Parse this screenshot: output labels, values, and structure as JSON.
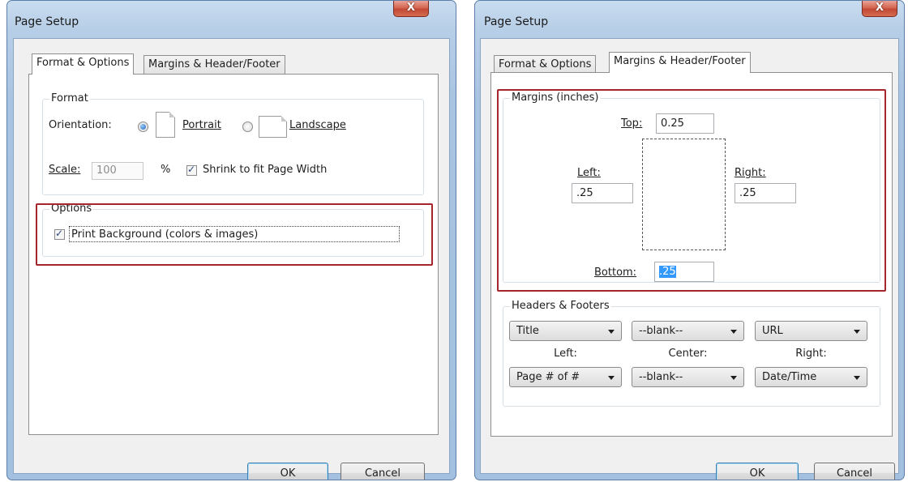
{
  "dialog1": {
    "title": "Page Setup",
    "close_label": "X",
    "tabs": [
      {
        "label": "Format & Options",
        "active": true
      },
      {
        "label": "Margins & Header/Footer",
        "active": false
      }
    ],
    "format": {
      "group_label": "Format",
      "orientation_label": "Orientation:",
      "portrait_label": "Portrait",
      "landscape_label": "Landscape",
      "orientation_selected": "Portrait",
      "scale_label": "Scale:",
      "scale_value": "100",
      "scale_unit": "%",
      "shrink_label": "Shrink to fit Page Width",
      "shrink_checked": true
    },
    "options": {
      "group_label": "Options",
      "print_background_label": "Print Background (colors & images)",
      "print_background_checked": true
    },
    "ok_label": "OK",
    "cancel_label": "Cancel"
  },
  "dialog2": {
    "title": "Page Setup",
    "close_label": "X",
    "tabs": [
      {
        "label": "Format & Options",
        "active": false
      },
      {
        "label": "Margins & Header/Footer",
        "active": true
      }
    ],
    "margins": {
      "group_label": "Margins (inches)",
      "top_label": "Top:",
      "top_value": "0.25",
      "left_label": "Left:",
      "left_value": ".25",
      "right_label": "Right:",
      "right_value": ".25",
      "bottom_label": "Bottom:",
      "bottom_value": ".25"
    },
    "headers_footers": {
      "group_label": "Headers & Footers",
      "header_left": "Title",
      "header_center": "--blank--",
      "header_right": "URL",
      "left_label": "Left:",
      "center_label": "Center:",
      "right_label": "Right:",
      "footer_left": "Page # of #",
      "footer_center": "--blank--",
      "footer_right": "Date/Time"
    },
    "ok_label": "OK",
    "cancel_label": "Cancel"
  },
  "colors": {
    "highlight": "#a5262c",
    "window_frame": "#a9c4e2",
    "close_button": "#c24934",
    "selection": "#3399ff"
  }
}
